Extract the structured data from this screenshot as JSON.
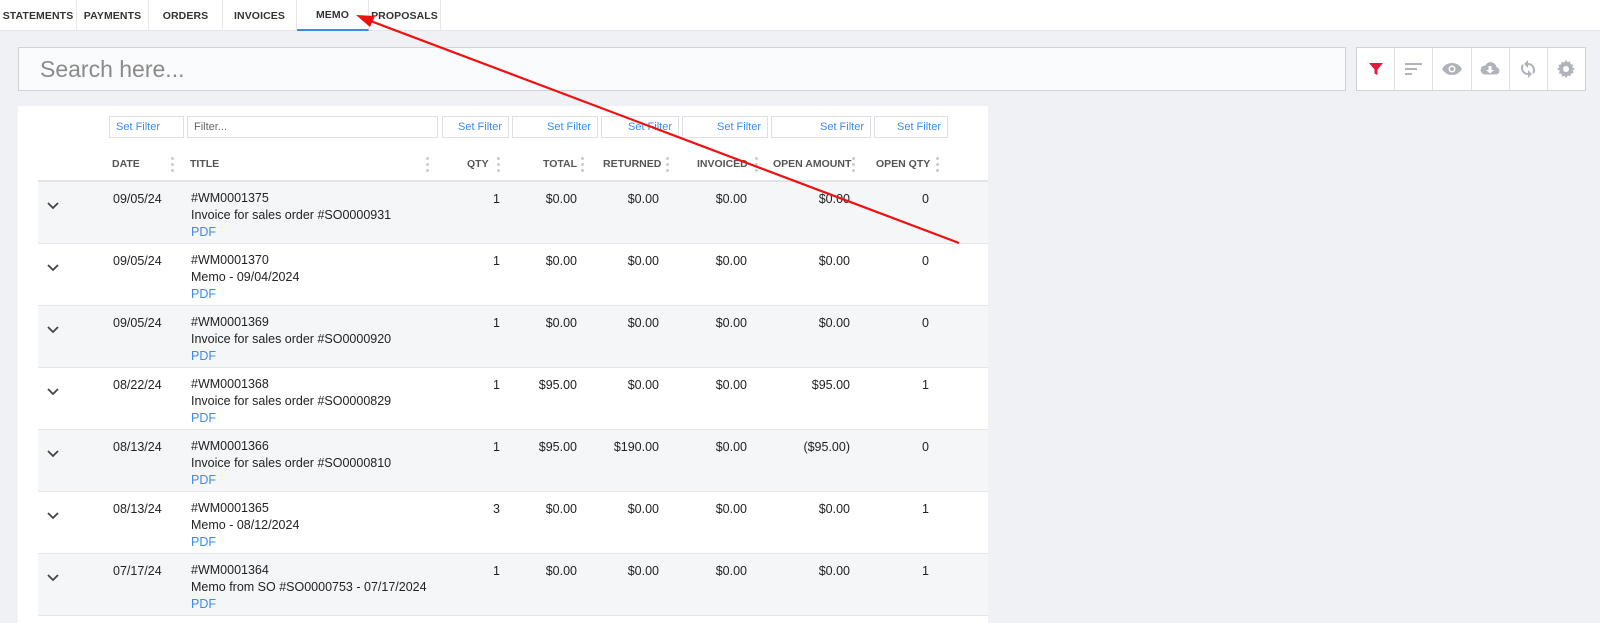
{
  "tabs": [
    {
      "label": "STATEMENTS"
    },
    {
      "label": "PAYMENTS"
    },
    {
      "label": "ORDERS"
    },
    {
      "label": "INVOICES"
    },
    {
      "label": "MEMO"
    },
    {
      "label": "PROPOSALS"
    }
  ],
  "active_tab": "MEMO",
  "search": {
    "placeholder": "Search here..."
  },
  "toolbar": {
    "buttons": [
      {
        "icon": "filter-icon",
        "color": "#e8193c"
      },
      {
        "icon": "sort-icon",
        "color": "#b0b4ba"
      },
      {
        "icon": "eye-icon",
        "color": "#b0b4ba"
      },
      {
        "icon": "cloud-download-icon",
        "color": "#b0b4ba"
      },
      {
        "icon": "refresh-icon",
        "color": "#b0b4ba"
      },
      {
        "icon": "gear-icon",
        "color": "#b0b4ba"
      }
    ]
  },
  "filters": {
    "date": "Set Filter",
    "title_placeholder": "Filter...",
    "qty": "Set Filter",
    "total": "Set Filter",
    "returned": "Set Filter",
    "invoiced": "Set Filter",
    "open_amount": "Set Filter",
    "open_qty": "Set Filter"
  },
  "columns": {
    "date": "DATE",
    "title": "TITLE",
    "qty": "QTY",
    "total": "TOTAL",
    "returned": "RETURNED",
    "invoiced": "INVOICED",
    "open_amount": "OPEN AMOUNT",
    "open_qty": "OPEN QTY"
  },
  "rows": [
    {
      "date": "09/05/24",
      "number": "#WM0001375",
      "desc": "Invoice for sales order #SO0000931",
      "link": "PDF",
      "qty": "1",
      "total": "$0.00",
      "returned": "$0.00",
      "invoiced": "$0.00",
      "open_amount": "$0.00",
      "open_qty": "0"
    },
    {
      "date": "09/05/24",
      "number": "#WM0001370",
      "desc": "Memo - 09/04/2024",
      "link": "PDF",
      "qty": "1",
      "total": "$0.00",
      "returned": "$0.00",
      "invoiced": "$0.00",
      "open_amount": "$0.00",
      "open_qty": "0"
    },
    {
      "date": "09/05/24",
      "number": "#WM0001369",
      "desc": "Invoice for sales order #SO0000920",
      "link": "PDF",
      "qty": "1",
      "total": "$0.00",
      "returned": "$0.00",
      "invoiced": "$0.00",
      "open_amount": "$0.00",
      "open_qty": "0"
    },
    {
      "date": "08/22/24",
      "number": "#WM0001368",
      "desc": "Invoice for sales order #SO0000829",
      "link": "PDF",
      "qty": "1",
      "total": "$95.00",
      "returned": "$0.00",
      "invoiced": "$0.00",
      "open_amount": "$95.00",
      "open_qty": "1"
    },
    {
      "date": "08/13/24",
      "number": "#WM0001366",
      "desc": "Invoice for sales order #SO0000810",
      "link": "PDF",
      "qty": "1",
      "total": "$95.00",
      "returned": "$190.00",
      "invoiced": "$0.00",
      "open_amount": "($95.00)",
      "open_qty": "0"
    },
    {
      "date": "08/13/24",
      "number": "#WM0001365",
      "desc": "Memo - 08/12/2024",
      "link": "PDF",
      "qty": "3",
      "total": "$0.00",
      "returned": "$0.00",
      "invoiced": "$0.00",
      "open_amount": "$0.00",
      "open_qty": "1"
    },
    {
      "date": "07/17/24",
      "number": "#WM0001364",
      "desc": "Memo from SO #SO0000753 - 07/17/2024",
      "link": "PDF",
      "qty": "1",
      "total": "$0.00",
      "returned": "$0.00",
      "invoiced": "$0.00",
      "open_amount": "$0.00",
      "open_qty": "1"
    }
  ],
  "colors": {
    "accent": "#3c8be8",
    "filter_active": "#e8193c",
    "annotation_arrow": "#ee1111"
  }
}
